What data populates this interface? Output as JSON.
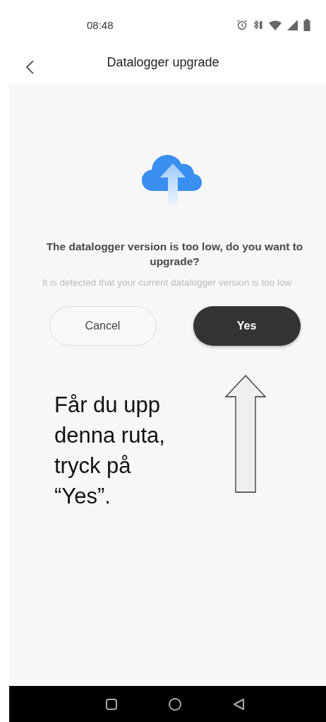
{
  "status_bar": {
    "time": "08:48"
  },
  "header": {
    "title": "Datalogger upgrade"
  },
  "dialog": {
    "title": "The datalogger version is too low, do you want to upgrade?",
    "message": "It is detected that your current datalogger version is too low",
    "buttons": [
      {
        "label": "Cancel",
        "kind": "secondary"
      },
      {
        "label": "Yes",
        "kind": "primary"
      }
    ]
  },
  "annotation": {
    "lines": [
      "Får du upp",
      "denna ruta,",
      "tryck på",
      "“Yes”."
    ]
  }
}
